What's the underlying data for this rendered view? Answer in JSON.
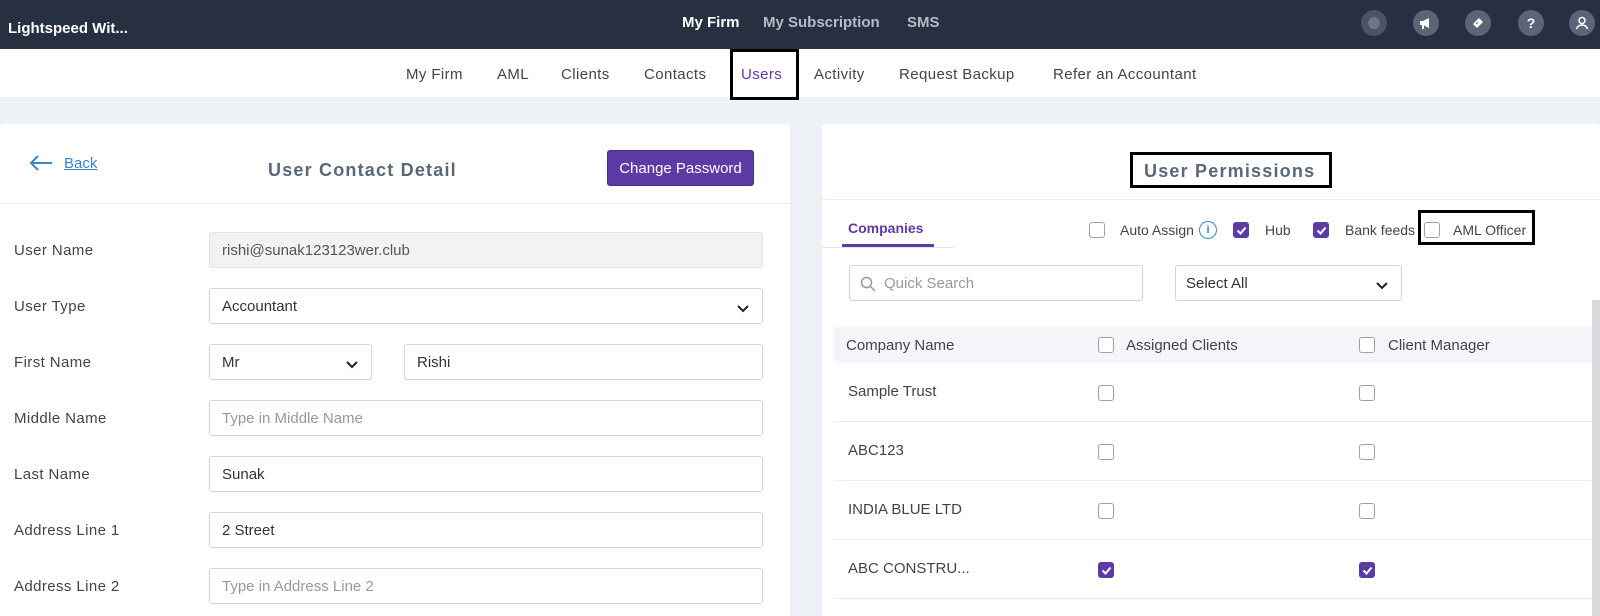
{
  "app": {
    "brand": "Lightspeed Wit..."
  },
  "topnav": {
    "items": [
      "My Firm",
      "My Subscription",
      "SMS"
    ],
    "active": "My Firm"
  },
  "topicons": [
    "user-initial-icon",
    "megaphone-icon",
    "ticket-icon",
    "help-icon",
    "account-icon"
  ],
  "subnav": {
    "items": [
      "My Firm",
      "AML",
      "Clients",
      "Contacts",
      "Users",
      "Activity",
      "Request Backup",
      "Refer an Accountant"
    ],
    "active": "Users"
  },
  "left": {
    "back_label": "Back",
    "title": "User Contact Detail",
    "change_password": "Change Password",
    "fields": {
      "user_name": {
        "label": "User Name",
        "value": "rishi@sunak123123wer.club"
      },
      "user_type": {
        "label": "User Type",
        "value": "Accountant"
      },
      "first_name": {
        "label": "First Name",
        "title_value": "Mr",
        "value": "Rishi"
      },
      "middle_name": {
        "label": "Middle Name",
        "placeholder": "Type in Middle Name"
      },
      "last_name": {
        "label": "Last Name",
        "value": "Sunak"
      },
      "address1": {
        "label": "Address Line 1",
        "value": "2 Street"
      },
      "address2": {
        "label": "Address Line 2",
        "placeholder": "Type in Address Line 2"
      }
    }
  },
  "right": {
    "title": "User Permissions",
    "tab": "Companies",
    "options": {
      "auto_assign": {
        "label": "Auto Assign",
        "checked": false
      },
      "hub": {
        "label": "Hub",
        "checked": true
      },
      "bank_feeds": {
        "label": "Bank feeds",
        "checked": true
      },
      "aml_officer": {
        "label": "AML Officer",
        "checked": false
      }
    },
    "search_placeholder": "Quick Search",
    "select_value": "Select All",
    "columns": [
      "Company Name",
      "Assigned Clients",
      "Client Manager"
    ],
    "rows": [
      {
        "name": "Sample Trust",
        "assigned": false,
        "manager": false
      },
      {
        "name": "ABC123",
        "assigned": false,
        "manager": false
      },
      {
        "name": "INDIA BLUE LTD",
        "assigned": false,
        "manager": false
      },
      {
        "name": "ABC CONSTRU...",
        "assigned": true,
        "manager": true
      }
    ]
  },
  "colors": {
    "topbar": "#263040",
    "accent": "#5e3aa5",
    "link": "#3a86c8"
  }
}
